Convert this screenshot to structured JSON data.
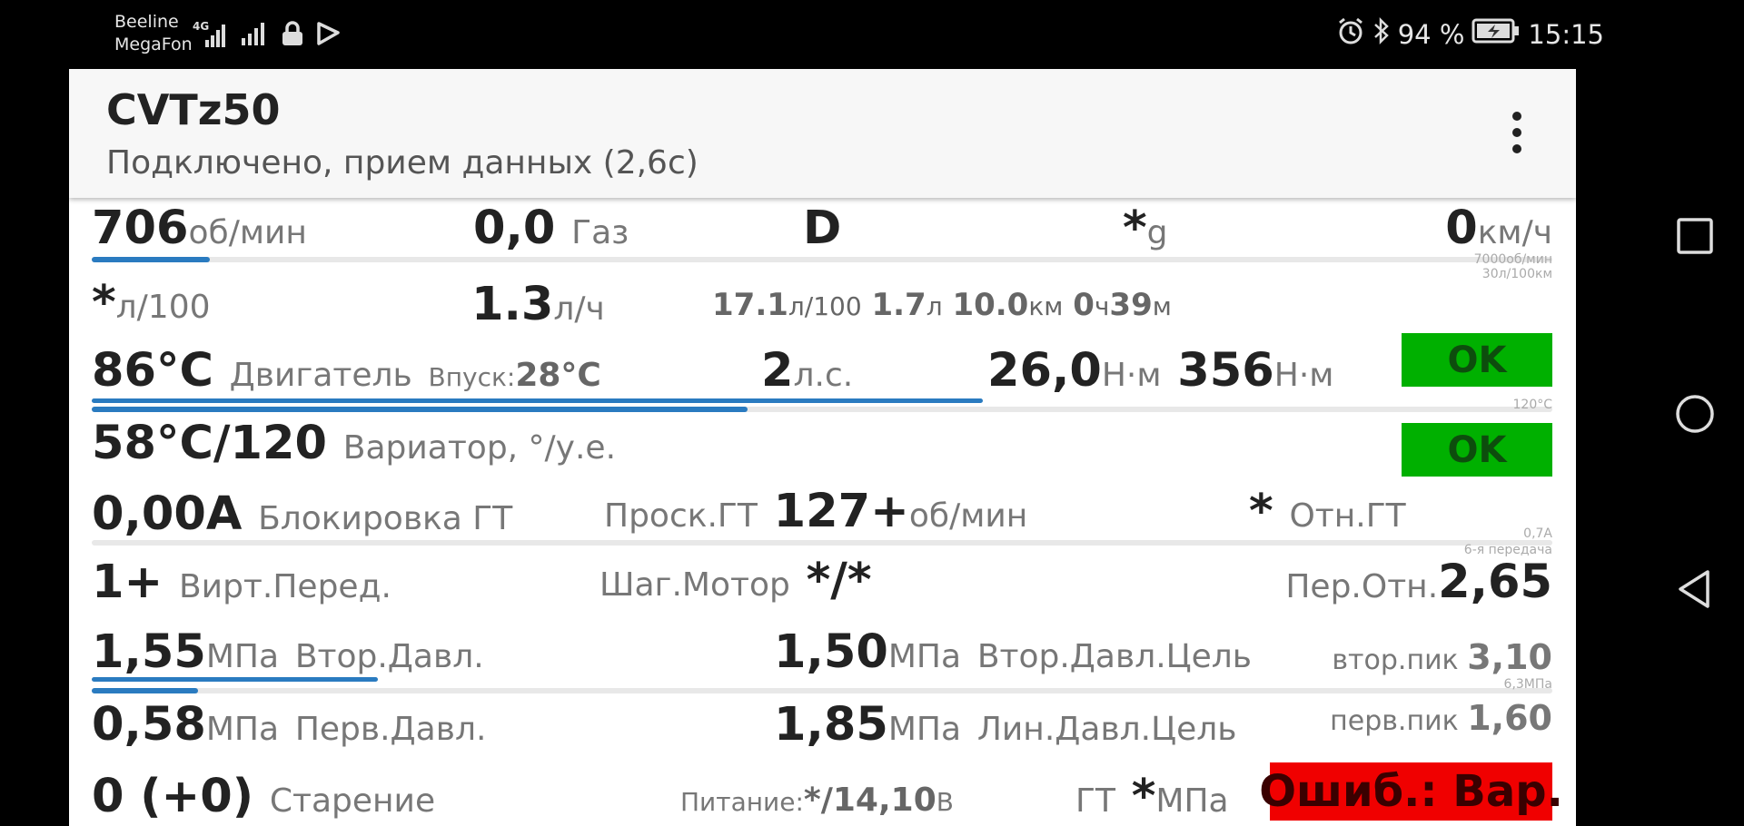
{
  "status_bar": {
    "carrier1": "Beeline",
    "carrier2": "MegaFon",
    "network": "4G",
    "battery": "94 %",
    "time": "15:15",
    "icons": [
      "signal-icon",
      "signal-icon",
      "lock-icon",
      "media-icon",
      "alarm-icon",
      "bluetooth-icon",
      "battery-charging-icon"
    ]
  },
  "app": {
    "title": "CVTz50",
    "subtitle": "Подключено, прием данных (2,6с)"
  },
  "row1": {
    "rpm": "706",
    "rpm_unit": "об/мин",
    "gas": "0,0",
    "gas_label": "Газ",
    "gear": "D",
    "g_val": "*",
    "g_unit": "g",
    "speed": "0",
    "speed_unit": "км/ч",
    "scale1": "7000об/мин",
    "scale2": "30л/100км",
    "rpm_fraction": 0.081
  },
  "row2": {
    "cons_val": "*",
    "cons_unit": "л/100",
    "lph_val": "1.3",
    "lph_unit": "л/ч",
    "trip_a": "17.1",
    "trip_a_unit": "л/100",
    "trip_b": "1.7",
    "trip_b_unit": "л",
    "trip_c": "10.0",
    "trip_c_unit": "км",
    "trip_h": "0",
    "trip_h_unit": "ч",
    "trip_m": "39",
    "trip_m_unit": "м"
  },
  "row3": {
    "engine_temp": "86°C",
    "engine_label": "Двигатель",
    "intake_label": "Впуск:",
    "intake_temp": "28°C",
    "hp": "2",
    "hp_unit": "л.с.",
    "torque1": "26,0",
    "torque1_unit": "Н·м",
    "torque2": "356",
    "torque2_unit": "Н·м",
    "status": "OK",
    "scale": "120°C",
    "bar1_fraction": 0.61,
    "bar2_fraction": 0.449
  },
  "row4": {
    "cvt_temp": "58°C/120",
    "cvt_label": "Вариатор, °/у.е.",
    "status": "OK"
  },
  "row5": {
    "lock_current": "0,00A",
    "lock_label": "Блокировка ГТ",
    "slip_label": "Проск.ГТ",
    "slip_val": "127+",
    "slip_unit": "об/мин",
    "ratio_val": "*",
    "ratio_label": "Отн.ГТ",
    "scale1": "0,7А",
    "scale2": "6-я передача"
  },
  "row6": {
    "virt_gear": "1+",
    "virt_label": "Вирт.Перед.",
    "step_label": "Шаг.Мотор",
    "step_val": "*/*",
    "gear_ratio_label": "Пер.Отн.",
    "gear_ratio": "2,65"
  },
  "row7": {
    "sec_press": "1,55",
    "sec_unit": "МПа",
    "sec_label": "Втор.Давл.",
    "sec_target": "1,50",
    "sec_target_unit": "МПа",
    "sec_target_label": "Втор.Давл.Цель",
    "sec_peak_label": "втор.пик",
    "sec_peak": "3,10",
    "scale": "6,3МПа",
    "bar1_fraction": 0.196,
    "bar2_fraction": 0.073
  },
  "row8": {
    "prim_press": "0,58",
    "prim_unit": "МПа",
    "prim_label": "Перв.Давл.",
    "line_target": "1,85",
    "line_target_unit": "МПа",
    "line_target_label": "Лин.Давл.Цель",
    "prim_peak_label": "перв.пик",
    "prim_peak": "1,60"
  },
  "row9": {
    "aging": "0 (+0)",
    "aging_label": "Старение",
    "power_label": "Питание:",
    "power_val": "*/14,10",
    "power_unit": "В",
    "gt_label": "ГТ",
    "gt_val": "*",
    "gt_unit": "МПа",
    "error": "Ошиб.: Вар."
  },
  "colors": {
    "accent_bar": "#2a7bc0",
    "ok_green": "#00b000",
    "error_red": "#f00000"
  }
}
